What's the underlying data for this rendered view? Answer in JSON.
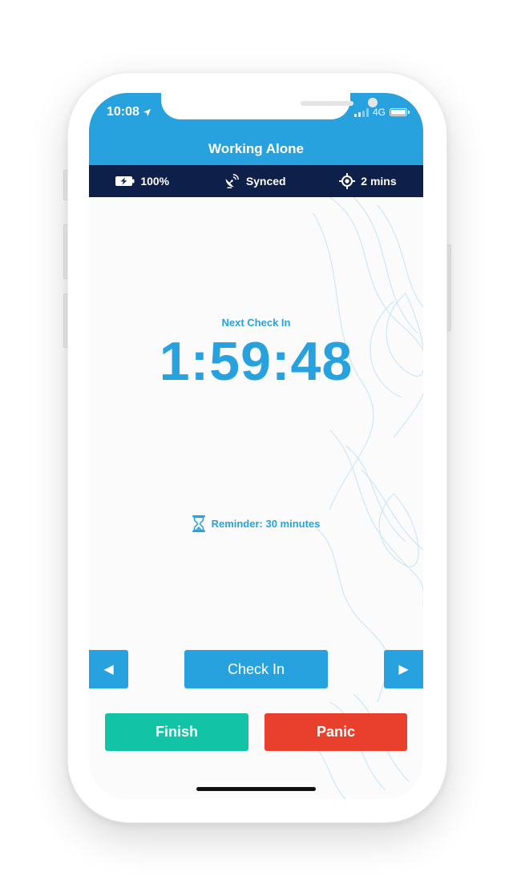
{
  "status_bar": {
    "time": "10:08",
    "network": "4G"
  },
  "app": {
    "title": "Working Alone"
  },
  "info_bar": {
    "battery": "100%",
    "sync": "Synced",
    "location": "2 mins"
  },
  "checkin": {
    "label": "Next Check In",
    "countdown": "1:59:48",
    "reminder": "Reminder: 30 minutes"
  },
  "buttons": {
    "prev_icon": "◀",
    "next_icon": "▶",
    "check_in": "Check In",
    "finish": "Finish",
    "panic": "Panic"
  },
  "colors": {
    "primary": "#27a2de",
    "navy": "#0e1f4a",
    "finish": "#13c3a6",
    "panic": "#e8402c"
  },
  "icons": [
    "location-arrow-icon",
    "signal-icon",
    "battery-icon",
    "charging-battery-icon",
    "satellite-dish-icon",
    "crosshair-icon",
    "hourglass-icon",
    "triangle-left-icon",
    "triangle-right-icon"
  ]
}
